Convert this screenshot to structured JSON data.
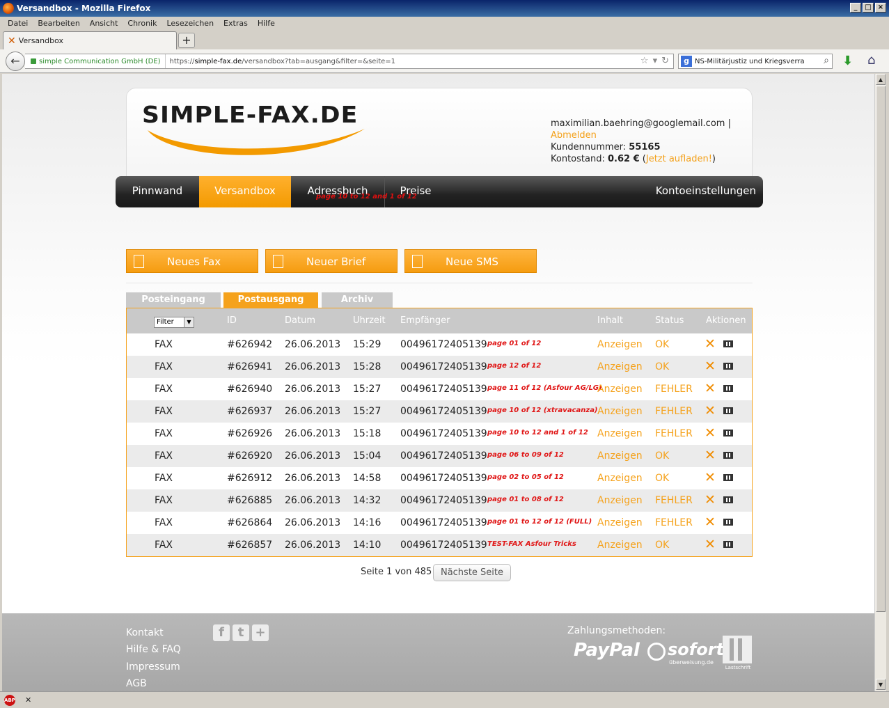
{
  "window": {
    "title": "Versandbox - Mozilla Firefox"
  },
  "menu": [
    "Datei",
    "Bearbeiten",
    "Ansicht",
    "Chronik",
    "Lesezeichen",
    "Extras",
    "Hilfe"
  ],
  "tab": {
    "title": "Versandbox"
  },
  "address": {
    "identity": "simple Communication GmbH (DE)",
    "url_prefix": "https://",
    "url_host": "simple-fax.de",
    "url_path": "/versandbox?tab=ausgang&filter=&seite=1"
  },
  "search": {
    "value": "NS-Militärjustiz und Kriegsverra"
  },
  "site": {
    "logo": "SIMPLE-FAX.DE",
    "user": {
      "email": "maximilian.baehring@googlemail.com",
      "separator": "|",
      "logout": "Abmelden",
      "customer_label": "Kundennummer:",
      "customer_number": "55165",
      "balance_label": "Kontostand:",
      "balance": "0.62 €",
      "topup_open": "(",
      "topup": "Jetzt aufladen!",
      "topup_close": ")"
    },
    "nav": {
      "pinnwand": "Pinnwand",
      "versandbox": "Versandbox",
      "adressbuch": "Adressbuch",
      "preise": "Preise",
      "konto": "Kontoeinstellungen",
      "overlay": "page 10 to 12 and 1 of 12"
    },
    "actions": {
      "fax": "Neues Fax",
      "brief": "Neuer Brief",
      "sms": "Neue SMS"
    },
    "tabs": {
      "inbox": "Posteingang",
      "outbox": "Postausgang",
      "archive": "Archiv"
    },
    "table": {
      "filter": "Filter",
      "headers": {
        "id": "ID",
        "date": "Datum",
        "time": "Uhrzeit",
        "recipient": "Empfänger",
        "content": "Inhalt",
        "status": "Status",
        "actions": "Aktionen"
      },
      "rows": [
        {
          "type": "FAX",
          "id": "#626942",
          "date": "26.06.2013",
          "time": "15:29",
          "recipient": "00496172405139",
          "note": "page 01 of 12",
          "content": "Anzeigen",
          "status": "OK"
        },
        {
          "type": "FAX",
          "id": "#626941",
          "date": "26.06.2013",
          "time": "15:28",
          "recipient": "00496172405139",
          "note": "page 12 of 12",
          "content": "Anzeigen",
          "status": "OK"
        },
        {
          "type": "FAX",
          "id": "#626940",
          "date": "26.06.2013",
          "time": "15:27",
          "recipient": "00496172405139",
          "note": "page 11 of 12 (Asfour AG/LG)",
          "content": "Anzeigen",
          "status": "FEHLER"
        },
        {
          "type": "FAX",
          "id": "#626937",
          "date": "26.06.2013",
          "time": "15:27",
          "recipient": "00496172405139",
          "note": "page 10 of 12 (xtravacanza)",
          "content": "Anzeigen",
          "status": "FEHLER"
        },
        {
          "type": "FAX",
          "id": "#626926",
          "date": "26.06.2013",
          "time": "15:18",
          "recipient": "00496172405139",
          "note": "page 10 to 12 and 1 of 12",
          "content": "Anzeigen",
          "status": "FEHLER"
        },
        {
          "type": "FAX",
          "id": "#626920",
          "date": "26.06.2013",
          "time": "15:04",
          "recipient": "00496172405139",
          "note": "page 06 to 09 of 12",
          "content": "Anzeigen",
          "status": "OK"
        },
        {
          "type": "FAX",
          "id": "#626912",
          "date": "26.06.2013",
          "time": "14:58",
          "recipient": "00496172405139",
          "note": "page 02 to 05 of 12",
          "content": "Anzeigen",
          "status": "OK"
        },
        {
          "type": "FAX",
          "id": "#626885",
          "date": "26.06.2013",
          "time": "14:32",
          "recipient": "00496172405139",
          "note": "page 01 to 08 of 12",
          "content": "Anzeigen",
          "status": "FEHLER"
        },
        {
          "type": "FAX",
          "id": "#626864",
          "date": "26.06.2013",
          "time": "14:16",
          "recipient": "00496172405139",
          "note": "page 01 to 12 of 12 (FULL)",
          "content": "Anzeigen",
          "status": "FEHLER"
        },
        {
          "type": "FAX",
          "id": "#626857",
          "date": "26.06.2013",
          "time": "14:10",
          "recipient": "00496172405139",
          "note": "TEST-FAX Asfour Tricks",
          "content": "Anzeigen",
          "status": "OK"
        }
      ]
    },
    "pager": {
      "text": "Seite 1 von 485",
      "next": "Nächste Seite"
    },
    "footer": {
      "links": [
        "Kontakt",
        "Hilfe & FAQ",
        "Impressum",
        "AGB"
      ],
      "payment_label": "Zahlungsmethoden:",
      "paypal": "PayPal",
      "sofort": "sofort",
      "sofort_sub": "überweisung.de",
      "lastschrift": "Lastschrift"
    }
  },
  "colors": {
    "accent": "#f5a21c",
    "error_note": "#e01515",
    "nav_dark": "#222222"
  }
}
